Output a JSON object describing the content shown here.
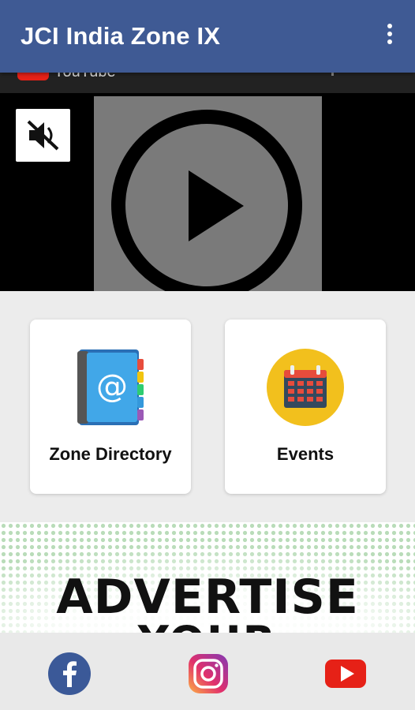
{
  "app_bar": {
    "title": "JCI India Zone IX",
    "menu_icon": "more-vert-icon",
    "background": "#3f5a94"
  },
  "video": {
    "provider_label": "YouTube",
    "mute_icon": "volume-off-icon",
    "play_icon": "play-circle-icon"
  },
  "tiles": [
    {
      "label": "Zone Directory",
      "icon": "address-book-icon"
    },
    {
      "label": "Events",
      "icon": "calendar-icon"
    }
  ],
  "banner": {
    "line1": "ADVERTISE",
    "line2": "YOUR"
  },
  "social": [
    {
      "name": "facebook",
      "icon": "facebook-icon",
      "color": "#3b5998"
    },
    {
      "name": "instagram",
      "icon": "instagram-icon",
      "color": "#d6249f"
    },
    {
      "name": "youtube",
      "icon": "youtube-icon",
      "color": "#e62117"
    }
  ]
}
